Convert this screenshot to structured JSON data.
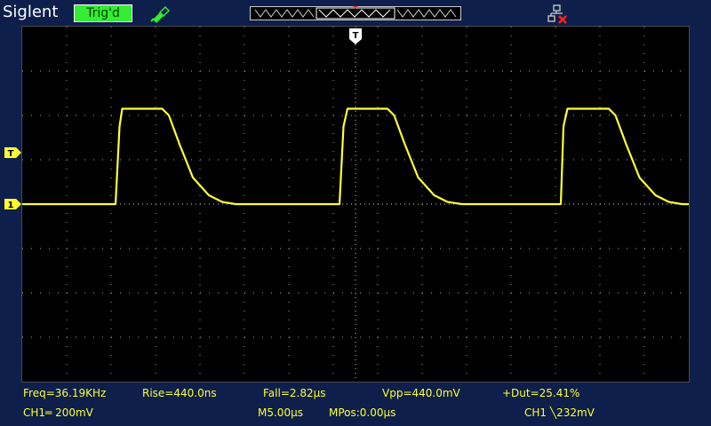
{
  "header": {
    "brand": "Siglent",
    "trigger_status": "Trig'd",
    "icons": [
      "probe-icon",
      "timebase-window-icon",
      "network-disconnected-icon"
    ]
  },
  "markers": {
    "trigger_level": "T",
    "channel1_ground": "1",
    "trigger_position": "T"
  },
  "measurements": {
    "freq": "Freq=36.19KHz",
    "rise": "Rise=440.0ns",
    "fall": "Fall=2.82µs",
    "vpp": "Vpp=440.0mV",
    "duty": "+Dut=25.41%"
  },
  "status": {
    "ch1_scale": "CH1═ 200mV",
    "time_scale": "M5.00µs",
    "m_pos": "MPos:0.00µs",
    "trigger_info": "CH1 ╲232mV"
  },
  "colors": {
    "background": "#0d1f4a",
    "screen": "#000000",
    "trace": "#ffff33",
    "grid": "#888888",
    "badge": "#33ee33"
  },
  "chart_data": {
    "type": "line",
    "title": "",
    "xlabel": "",
    "ylabel": "",
    "x_unit": "µs",
    "y_unit": "V",
    "xlim": [
      -25,
      25
    ],
    "ylim": [
      -0.8,
      0.8
    ],
    "grid": true,
    "series": [
      {
        "color": "#ffff33",
        "x": [
          -25,
          -24.2,
          -18.0,
          -17.7,
          -17.5,
          -14.5,
          -14.0,
          -13.2,
          -12.2,
          -11.0,
          -10.0,
          -9.0,
          -1.2,
          -0.9,
          -0.6,
          2.4,
          2.9,
          3.7,
          4.7,
          5.9,
          6.9,
          8.0,
          15.4,
          15.6,
          15.9,
          19.0,
          19.5,
          20.3,
          21.3,
          22.5,
          23.5,
          24.5,
          25
        ],
        "y": [
          0.0,
          0.0,
          0.0,
          0.35,
          0.43,
          0.43,
          0.4,
          0.27,
          0.12,
          0.04,
          0.01,
          0.0,
          0.0,
          0.35,
          0.43,
          0.43,
          0.4,
          0.27,
          0.12,
          0.04,
          0.01,
          0.0,
          0.0,
          0.35,
          0.43,
          0.43,
          0.4,
          0.27,
          0.12,
          0.04,
          0.01,
          0.0,
          0.0
        ]
      }
    ]
  }
}
